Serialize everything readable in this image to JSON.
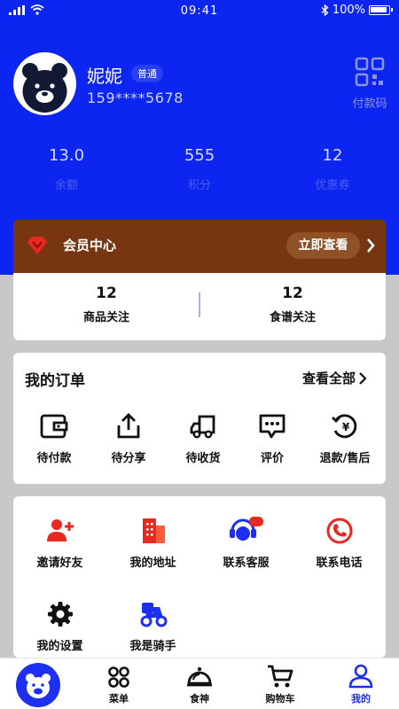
{
  "status_bar": {
    "time": "09:41",
    "battery": "100%"
  },
  "profile": {
    "name": "妮妮",
    "level": "普通",
    "phone": "159****5678",
    "paycode_label": "付款码"
  },
  "stats": [
    {
      "value": "13.0",
      "label": "余额"
    },
    {
      "value": "555",
      "label": "积分"
    },
    {
      "value": "12",
      "label": "优惠券"
    }
  ],
  "vip": {
    "title": "会员中心",
    "button": "立即查看"
  },
  "follows": [
    {
      "value": "12",
      "label": "商品关注"
    },
    {
      "value": "12",
      "label": "食谱关注"
    }
  ],
  "orders": {
    "title": "我的订单",
    "view_all": "查看全部",
    "items": [
      {
        "label": "待付款",
        "icon": "wallet-icon"
      },
      {
        "label": "待分享",
        "icon": "share-icon"
      },
      {
        "label": "待收货",
        "icon": "truck-icon"
      },
      {
        "label": "评价",
        "icon": "comment-icon"
      },
      {
        "label": "退款/售后",
        "icon": "refund-icon"
      }
    ]
  },
  "services": [
    {
      "label": "邀请好友",
      "icon": "invite-friend-icon"
    },
    {
      "label": "我的地址",
      "icon": "address-icon"
    },
    {
      "label": "联系客服",
      "icon": "customer-service-icon"
    },
    {
      "label": "联系电话",
      "icon": "phone-icon"
    },
    {
      "label": "我的设置",
      "icon": "settings-icon"
    },
    {
      "label": "我是骑手",
      "icon": "rider-icon"
    }
  ],
  "tabs": [
    {
      "label": "菜单",
      "icon": "menu-icon"
    },
    {
      "label": "食神",
      "icon": "chef-dish-icon"
    },
    {
      "label": "购物车",
      "icon": "cart-icon"
    },
    {
      "label": "我的",
      "icon": "user-icon"
    }
  ],
  "colors": {
    "brand_blue": "#0d25f0",
    "vip_brown": "#773611",
    "icon_red": "#e8291f",
    "tab_active": "#1d2ff0"
  }
}
